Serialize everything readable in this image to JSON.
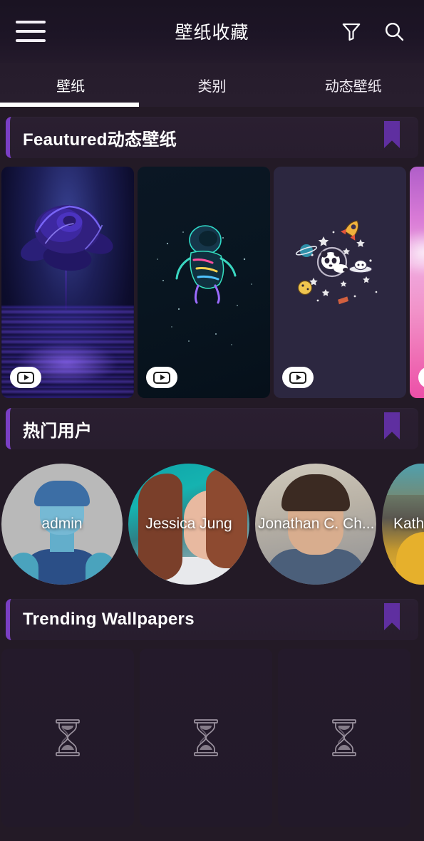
{
  "app": {
    "title": "壁纸收藏",
    "background_color": "#231a26",
    "accent_color": "#7a3fc4"
  },
  "header": {
    "menu_icon": "hamburger-icon",
    "filter_icon": "filter-icon",
    "search_icon": "search-icon"
  },
  "tabs": {
    "items": [
      {
        "label": "壁纸",
        "active": true
      },
      {
        "label": "类别",
        "active": false
      },
      {
        "label": "动态壁纸",
        "active": false
      }
    ]
  },
  "sections": {
    "featured": {
      "title": "Feautured动态壁纸",
      "ribbon_icon": "bookmark-ribbon-icon",
      "cards": [
        {
          "name": "blue-rose-reflection",
          "badge_icon": "play-icon"
        },
        {
          "name": "neon-astronaut",
          "badge_icon": "play-icon"
        },
        {
          "name": "panda-in-space",
          "badge_icon": "play-icon"
        },
        {
          "name": "pink-clouds",
          "badge_icon": "play-icon"
        }
      ]
    },
    "popular_users": {
      "title": "热门用户",
      "ribbon_icon": "bookmark-ribbon-icon",
      "users": [
        {
          "name": "admin"
        },
        {
          "name": "Jessica Jung"
        },
        {
          "name": "Jonathan C. Ch..."
        },
        {
          "name": "Kathy"
        }
      ]
    },
    "trending": {
      "title": "Trending Wallpapers",
      "ribbon_icon": "bookmark-ribbon-icon",
      "placeholders": [
        {
          "icon": "hourglass-icon"
        },
        {
          "icon": "hourglass-icon"
        },
        {
          "icon": "hourglass-icon"
        }
      ]
    }
  }
}
